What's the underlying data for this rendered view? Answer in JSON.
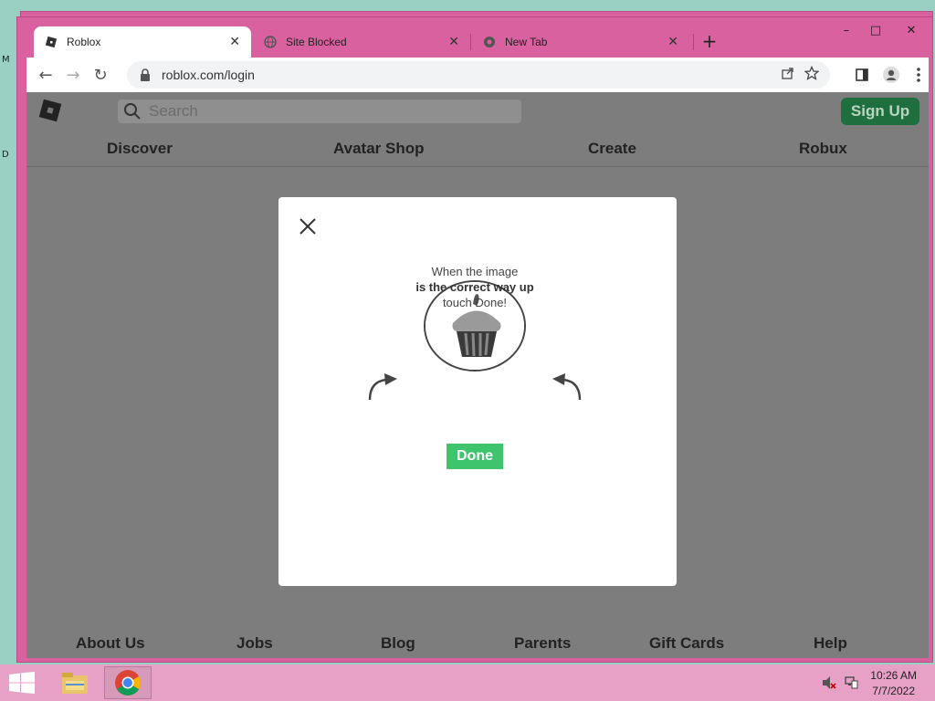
{
  "desktop": {
    "glyph1": "M",
    "glyph2": "D"
  },
  "back_window": {
    "minimize": "–",
    "maximize": "□",
    "close": "✕"
  },
  "window": {
    "minimize": "–",
    "maximize": "□",
    "close": "✕"
  },
  "tabs": [
    {
      "label": "Roblox",
      "icon": "roblox-favicon",
      "active": true,
      "close": "✕"
    },
    {
      "label": "Site Blocked",
      "icon": "globe-icon",
      "active": false,
      "close": "✕"
    },
    {
      "label": "New Tab",
      "icon": "chrome-icon",
      "active": false,
      "close": "✕"
    }
  ],
  "new_tab_label": "+",
  "toolbar": {
    "back": "←",
    "forward": "→",
    "reload": "↻",
    "url": "roblox.com/login"
  },
  "roblox": {
    "search_placeholder": "Search",
    "signup_label": "Sign Up",
    "nav": [
      "Discover",
      "Avatar Shop",
      "Create",
      "Robux"
    ],
    "footer": [
      "About Us",
      "Jobs",
      "Blog",
      "Parents",
      "Gift Cards",
      "Help"
    ]
  },
  "captcha": {
    "line1": "When the image",
    "line2": "is the correct way up",
    "line3": "touch Done!",
    "done_label": "Done"
  },
  "taskbar": {
    "time": "10:26 AM",
    "date": "7/7/2022"
  },
  "colors": {
    "window_frame": "#d9619f",
    "done_green": "#3fc46e",
    "signup_green": "#1f6f3e",
    "page_overlay": "#7d7d7d"
  }
}
